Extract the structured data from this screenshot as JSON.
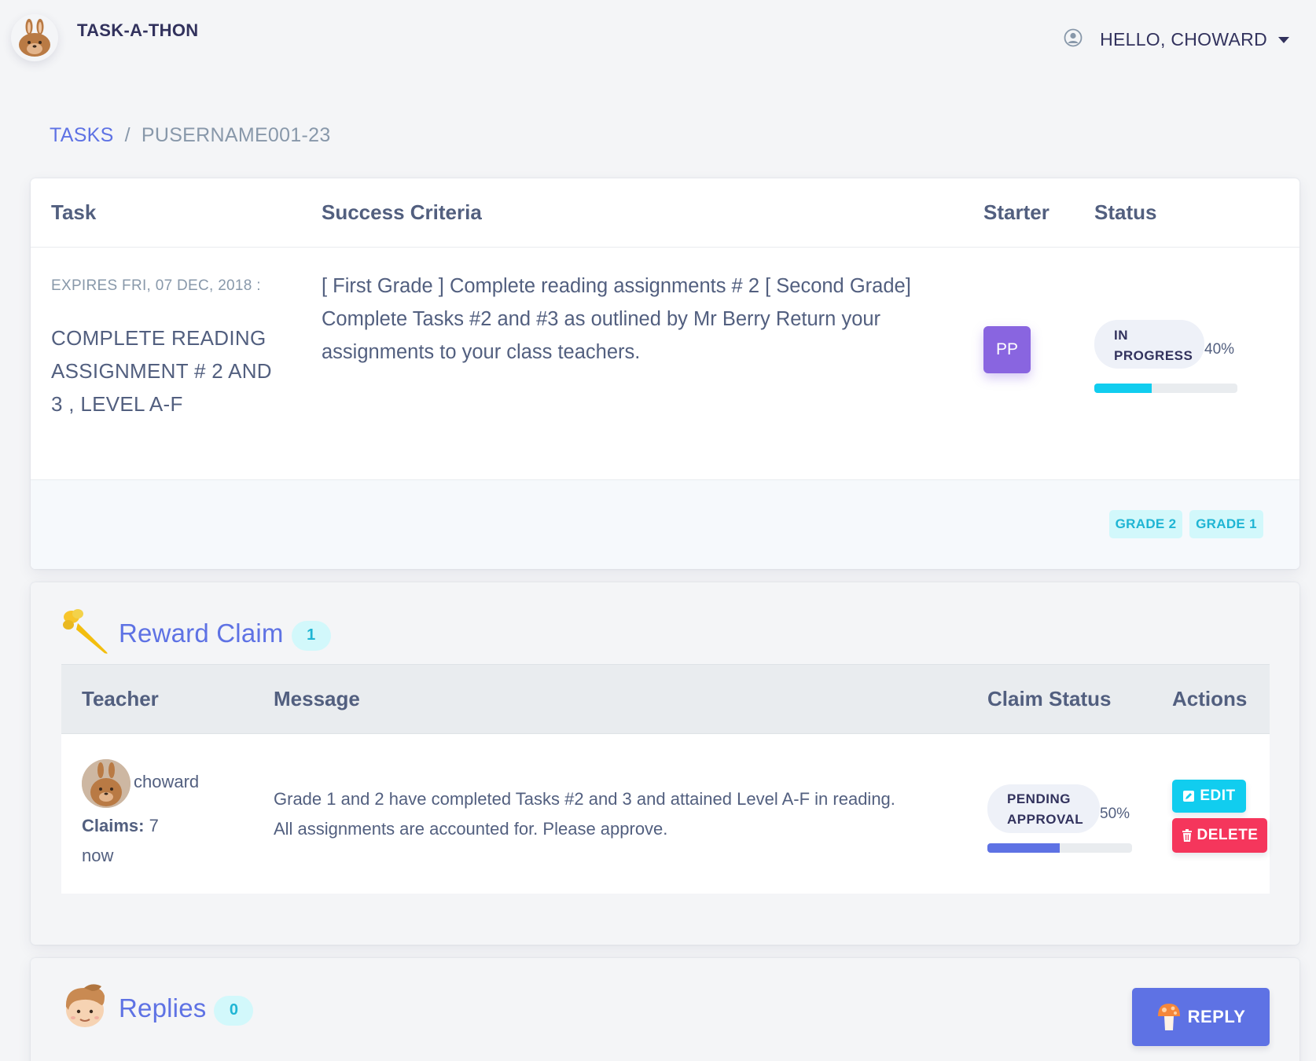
{
  "app": {
    "name": "TASK-A-THON",
    "logo_icon": "bunny-logo-icon"
  },
  "user": {
    "greeting": "HELLO, CHOWARD",
    "icon": "user-circle-icon"
  },
  "breadcrumb": {
    "root": "TASKS",
    "separator": "/",
    "current": "PUSERNAME001-23"
  },
  "task_table": {
    "headers": {
      "task": "Task",
      "criteria": "Success Criteria",
      "starter": "Starter",
      "status": "Status"
    },
    "row": {
      "expires": "EXPIRES FRI, 07 DEC, 2018 :",
      "title": "COMPLETE READING ASSIGNMENT # 2 AND 3 , LEVEL A-F",
      "criteria": "[ First Grade ] Complete reading assignments # 2 [ Second Grade] Complete Tasks #2 and #3 as outlined by Mr Berry Return your assignments to your class teachers.",
      "starter_initials": "PP",
      "status_line1": "IN",
      "status_line2": "PROGRESS",
      "progress_label": "40%",
      "progress_value": 0.4
    },
    "tags": [
      "GRADE 2",
      "GRADE 1"
    ]
  },
  "reward_claim": {
    "title": "Reward Claim",
    "count": "1",
    "icon": "carrot-icon",
    "headers": {
      "teacher": "Teacher",
      "message": "Message",
      "claim_status": "Claim Status",
      "actions": "Actions"
    },
    "row": {
      "teacher_name": "choward",
      "claims_label": "Claims:",
      "claims_value": "7",
      "time": "now",
      "message": "Grade 1 and 2 have completed Tasks #2 and 3 and attained Level A-F in reading. All assignments are accounted for. Please approve.",
      "status_line1": "PENDING",
      "status_line2": "APPROVAL",
      "progress_label": "50%",
      "progress_value": 0.5,
      "edit_label": "EDIT",
      "delete_label": "DELETE"
    }
  },
  "replies": {
    "title": "Replies",
    "count": "0",
    "icon": "boy-face-icon",
    "reply_label": "REPLY",
    "reply_icon": "mushroom-icon"
  },
  "colors": {
    "primary": "#5e72e4",
    "info": "#11cdef",
    "danger": "#f5365c",
    "purple": "#8965e0",
    "progress_info": "#11cdef",
    "progress_primary": "#5e72e4",
    "text": "#525f7f",
    "muted": "#8898aa"
  }
}
